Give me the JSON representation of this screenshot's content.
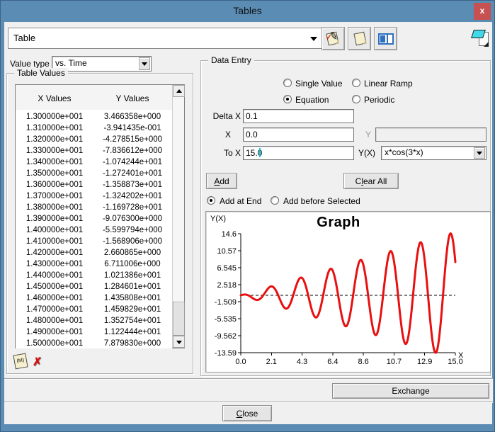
{
  "window": {
    "title": "Tables",
    "close_glyph": "x"
  },
  "toolbar": {
    "table_combo_value": "Table"
  },
  "glyphs": {
    "pencil": "✎",
    "check": "✓",
    "delete_x": "✗",
    "memo": "(M)"
  },
  "left_panel": {
    "value_type_label": "Value type",
    "value_type_value": "vs. Time",
    "group_title": "Table Values",
    "columns": [
      "X Values",
      "Y Values"
    ],
    "rows": [
      [
        "1.300000e+001",
        "3.466358e+000"
      ],
      [
        "1.310000e+001",
        "-3.941435e-001"
      ],
      [
        "1.320000e+001",
        "-4.278515e+000"
      ],
      [
        "1.330000e+001",
        "-7.836612e+000"
      ],
      [
        "1.340000e+001",
        "-1.074244e+001"
      ],
      [
        "1.350000e+001",
        "-1.272401e+001"
      ],
      [
        "1.360000e+001",
        "-1.358873e+001"
      ],
      [
        "1.370000e+001",
        "-1.324202e+001"
      ],
      [
        "1.380000e+001",
        "-1.169728e+001"
      ],
      [
        "1.390000e+001",
        "-9.076300e+000"
      ],
      [
        "1.400000e+001",
        "-5.599794e+000"
      ],
      [
        "1.410000e+001",
        "-1.568906e+000"
      ],
      [
        "1.420000e+001",
        "2.660865e+000"
      ],
      [
        "1.430000e+001",
        "6.711006e+000"
      ],
      [
        "1.440000e+001",
        "1.021386e+001"
      ],
      [
        "1.450000e+001",
        "1.284601e+001"
      ],
      [
        "1.460000e+001",
        "1.435808e+001"
      ],
      [
        "1.470000e+001",
        "1.459829e+001"
      ],
      [
        "1.480000e+001",
        "1.352754e+001"
      ],
      [
        "1.490000e+001",
        "1.122444e+001"
      ],
      [
        "1.500000e+001",
        "7.879830e+000"
      ]
    ]
  },
  "data_entry": {
    "group_title": "Data Entry",
    "mode_options": [
      "Single Value",
      "Linear Ramp",
      "Equation",
      "Periodic"
    ],
    "selected_mode": "Equation",
    "delta_x_label": "Delta X",
    "delta_x_value": "0.1",
    "x_label": "X",
    "x_value": "0.0",
    "y_label": "Y",
    "y_value": "",
    "to_x_label": "To X",
    "to_x_value": "15.0",
    "yx_label": "Y(X)",
    "yx_value": "x*cos(3*x)",
    "add_button": "Add",
    "clear_all_button": "Clear All",
    "insert_options": [
      "Add at End",
      "Add before Selected"
    ],
    "selected_insert": "Add at End"
  },
  "chart_data": {
    "type": "line",
    "title": "Graph",
    "ylabel": "Y(X)",
    "xlabel": "X",
    "equation": "x*cos(3*x)",
    "equation_params": {
      "k": 3
    },
    "x_range": [
      0,
      15
    ],
    "ylim": [
      -13.59,
      14.6
    ],
    "x_ticks": [
      "0.0",
      "2.1",
      "4.3",
      "6.4",
      "8.6",
      "10.7",
      "12.9",
      "15.0"
    ],
    "y_ticks": [
      "14.6",
      "10.57",
      "6.545",
      "2.518",
      "-1.509",
      "-5.535",
      "-9.562",
      "-13.59"
    ],
    "reference_line_y": 0,
    "grid": false,
    "legend": false,
    "series": [
      {
        "name": "x*cos(3*x)",
        "color": "#e81010"
      }
    ]
  },
  "footer": {
    "exchange_button": "Exchange",
    "close_button": "Close"
  }
}
